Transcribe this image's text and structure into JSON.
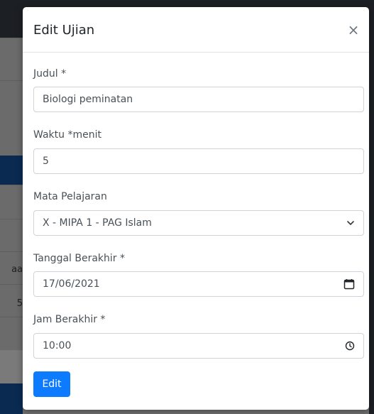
{
  "background": {
    "snippet_1": "aa",
    "snippet_2": "5"
  },
  "modal": {
    "title": "Edit Ujian",
    "close_symbol": "×",
    "fields": [
      {
        "label": "Judul *",
        "value": "Biologi peminatan"
      },
      {
        "label": "Waktu *menit",
        "value": "5"
      },
      {
        "label": "Mata Pelajaran",
        "value": "X - MIPA 1 - PAG Islam",
        "icon": "chevron-down-icon"
      },
      {
        "label": "Tanggal Berakhir *",
        "value": "17/06/2021",
        "icon": "calendar-icon"
      },
      {
        "label": "Jam Berakhir *",
        "value": "10:00",
        "icon": "clock-icon"
      }
    ],
    "submit_label": "Edit"
  },
  "colors": {
    "primary_button": "#0d7bff",
    "overlay_dark": "#1c1f23",
    "overlay_blue": "#0a2a52"
  }
}
